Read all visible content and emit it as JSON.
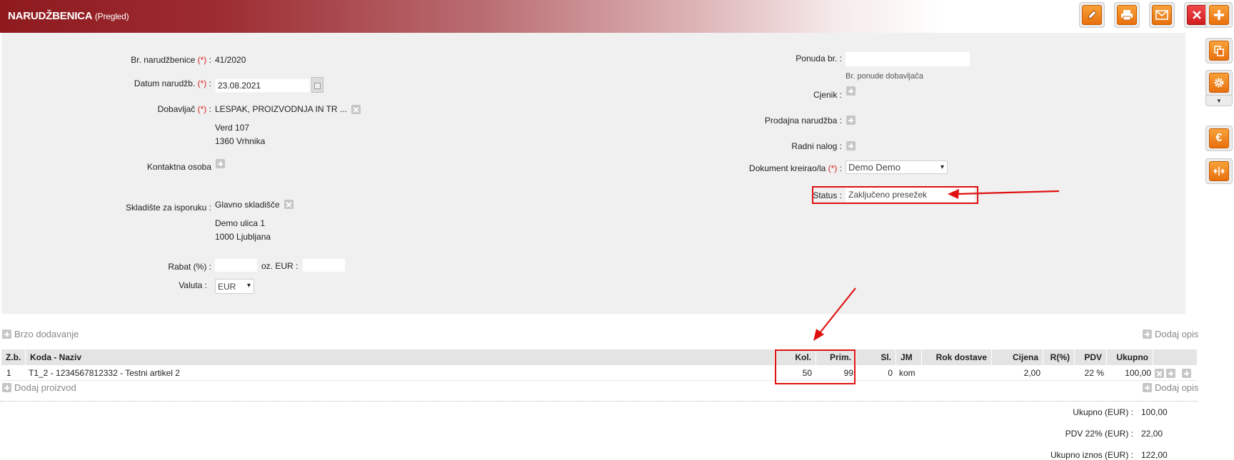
{
  "header": {
    "title": "NARUDŽBENICA",
    "subtitle": "(Pregled)"
  },
  "toolbar": {
    "edit": "pencil-icon",
    "print": "printer-icon",
    "email": "envelope-icon",
    "close": "close-icon",
    "add": "plus-icon",
    "copy": "copy-icon",
    "settings": "gear-icon",
    "currency": "euro-icon",
    "split": "split-icon"
  },
  "left": {
    "order_no_label": "Br. narudžbenice",
    "order_no_value": "41/2020",
    "date_label": "Datum narudžb.",
    "date_value": "23.08.2021",
    "supplier_label": "Dobavljač",
    "supplier_name": "LESPAK, PROIZVODNJA IN TR ...",
    "supplier_street": "Verd 107",
    "supplier_city": "1360 Vrhnika",
    "contact_label": "Kontaktna osoba",
    "warehouse_label": "Skladište za isporuku :",
    "warehouse_name": "Glavno skladišče",
    "warehouse_street": "Demo ulica 1",
    "warehouse_city": "1000 Ljubljana",
    "discount_label": "Rabat (%) :",
    "discount_eur_label": "oz. EUR :",
    "discount_pct": "",
    "discount_eur": "",
    "currency_label": "Valuta :",
    "currency_value": "EUR",
    "required_mark": "(*)",
    "colon": ":"
  },
  "right": {
    "offer_label": "Ponuda br. :",
    "offer_value": "",
    "offer_hint": "Br. ponude dobavljača",
    "pricelist_label": "Cjenik :",
    "sales_order_label": "Prodajna narudžba :",
    "work_order_label": "Radni nalog :",
    "created_by_label": "Dokument kreirao/la",
    "created_by_value": "Demo Demo",
    "status_label": "Status :",
    "status_value": "Zaključeno presežek"
  },
  "actions": {
    "quick_add": "Brzo dodavanje",
    "add_description": "Dodaj opis",
    "add_product": "Dodaj proizvod"
  },
  "table": {
    "columns": [
      "Z.b.",
      "Koda - Naziv",
      "Kol.",
      "Prim.",
      "Sl.",
      "JM",
      "Rok dostave",
      "Cijena",
      "R(%)",
      "PDV",
      "Ukupno"
    ],
    "rows": [
      {
        "zb": "1",
        "name": "T1_2 - 1234567812332 - Testni artikel 2",
        "qty": "50",
        "received": "99",
        "sl": "0",
        "unit": "kom",
        "delivery": "",
        "price": "2,00",
        "discount": "",
        "vat": "22 %",
        "total": "100,00"
      }
    ]
  },
  "totals": {
    "subtotal_label": "Ukupno (EUR) :",
    "subtotal_value": "100,00",
    "vat_label": "PDV 22% (EUR) :",
    "vat_value": "22,00",
    "grand_label": "Ukupno iznos (EUR) :",
    "grand_value": "122,00"
  },
  "colors": {
    "brand": "#8e1a1e",
    "accent_orange": "#f08a1c",
    "annotation_red": "#e01010"
  }
}
